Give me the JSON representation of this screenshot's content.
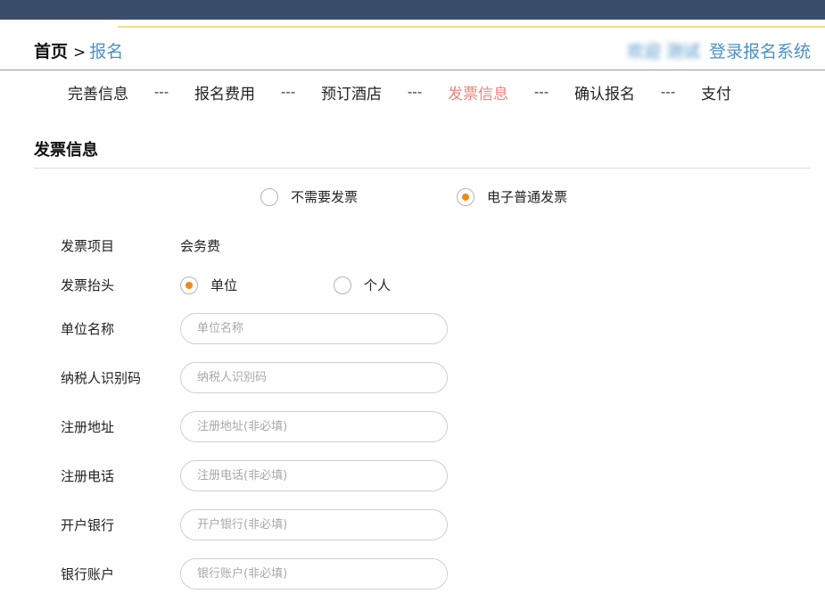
{
  "breadcrumb": {
    "home": "首页",
    "separator": ">",
    "current": "报名"
  },
  "header": {
    "welcome": "欢迎 测试",
    "login_link": "登录报名系统"
  },
  "steps": [
    {
      "label": "完善信息"
    },
    {
      "label": "报名费用"
    },
    {
      "label": "预订酒店"
    },
    {
      "label": "发票信息",
      "active": true
    },
    {
      "label": "确认报名"
    },
    {
      "label": "支付"
    }
  ],
  "step_separator": "---",
  "section": {
    "title": "发票信息"
  },
  "invoice_type": {
    "options": [
      {
        "label": "不需要发票",
        "checked": false
      },
      {
        "label": "电子普通发票",
        "checked": true
      }
    ]
  },
  "form": {
    "item_label": "发票项目",
    "item_value": "会务费",
    "header_label": "发票抬头",
    "header_options": [
      {
        "label": "单位",
        "checked": true
      },
      {
        "label": "个人",
        "checked": false
      }
    ],
    "fields": [
      {
        "label": "单位名称",
        "placeholder": "单位名称",
        "value": ""
      },
      {
        "label": "纳税人识别码",
        "placeholder": "纳税人识别码",
        "value": ""
      },
      {
        "label": "注册地址",
        "placeholder": "注册地址(非必填)",
        "value": ""
      },
      {
        "label": "注册电话",
        "placeholder": "注册电话(非必填)",
        "value": ""
      },
      {
        "label": "开户银行",
        "placeholder": "开户银行(非必填)",
        "value": ""
      },
      {
        "label": "银行账户",
        "placeholder": "银行账户(非必填)",
        "value": ""
      }
    ]
  },
  "colors": {
    "topbar": "#3a4e6b",
    "accent_link": "#4a90c4",
    "active_step": "#e8867c",
    "radio_checked": "#ee8a1c"
  }
}
